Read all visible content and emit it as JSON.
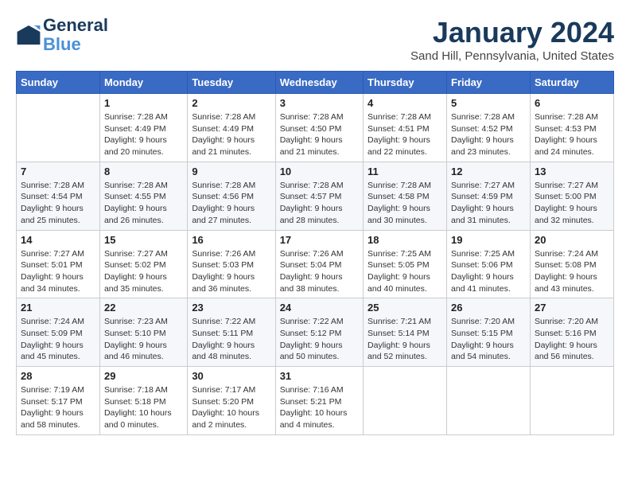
{
  "header": {
    "logo_line1": "General",
    "logo_line2": "Blue",
    "month_title": "January 2024",
    "location": "Sand Hill, Pennsylvania, United States"
  },
  "days_of_week": [
    "Sunday",
    "Monday",
    "Tuesday",
    "Wednesday",
    "Thursday",
    "Friday",
    "Saturday"
  ],
  "weeks": [
    [
      {
        "day": "",
        "info": ""
      },
      {
        "day": "1",
        "info": "Sunrise: 7:28 AM\nSunset: 4:49 PM\nDaylight: 9 hours\nand 20 minutes."
      },
      {
        "day": "2",
        "info": "Sunrise: 7:28 AM\nSunset: 4:49 PM\nDaylight: 9 hours\nand 21 minutes."
      },
      {
        "day": "3",
        "info": "Sunrise: 7:28 AM\nSunset: 4:50 PM\nDaylight: 9 hours\nand 21 minutes."
      },
      {
        "day": "4",
        "info": "Sunrise: 7:28 AM\nSunset: 4:51 PM\nDaylight: 9 hours\nand 22 minutes."
      },
      {
        "day": "5",
        "info": "Sunrise: 7:28 AM\nSunset: 4:52 PM\nDaylight: 9 hours\nand 23 minutes."
      },
      {
        "day": "6",
        "info": "Sunrise: 7:28 AM\nSunset: 4:53 PM\nDaylight: 9 hours\nand 24 minutes."
      }
    ],
    [
      {
        "day": "7",
        "info": "Sunrise: 7:28 AM\nSunset: 4:54 PM\nDaylight: 9 hours\nand 25 minutes."
      },
      {
        "day": "8",
        "info": "Sunrise: 7:28 AM\nSunset: 4:55 PM\nDaylight: 9 hours\nand 26 minutes."
      },
      {
        "day": "9",
        "info": "Sunrise: 7:28 AM\nSunset: 4:56 PM\nDaylight: 9 hours\nand 27 minutes."
      },
      {
        "day": "10",
        "info": "Sunrise: 7:28 AM\nSunset: 4:57 PM\nDaylight: 9 hours\nand 28 minutes."
      },
      {
        "day": "11",
        "info": "Sunrise: 7:28 AM\nSunset: 4:58 PM\nDaylight: 9 hours\nand 30 minutes."
      },
      {
        "day": "12",
        "info": "Sunrise: 7:27 AM\nSunset: 4:59 PM\nDaylight: 9 hours\nand 31 minutes."
      },
      {
        "day": "13",
        "info": "Sunrise: 7:27 AM\nSunset: 5:00 PM\nDaylight: 9 hours\nand 32 minutes."
      }
    ],
    [
      {
        "day": "14",
        "info": "Sunrise: 7:27 AM\nSunset: 5:01 PM\nDaylight: 9 hours\nand 34 minutes."
      },
      {
        "day": "15",
        "info": "Sunrise: 7:27 AM\nSunset: 5:02 PM\nDaylight: 9 hours\nand 35 minutes."
      },
      {
        "day": "16",
        "info": "Sunrise: 7:26 AM\nSunset: 5:03 PM\nDaylight: 9 hours\nand 36 minutes."
      },
      {
        "day": "17",
        "info": "Sunrise: 7:26 AM\nSunset: 5:04 PM\nDaylight: 9 hours\nand 38 minutes."
      },
      {
        "day": "18",
        "info": "Sunrise: 7:25 AM\nSunset: 5:05 PM\nDaylight: 9 hours\nand 40 minutes."
      },
      {
        "day": "19",
        "info": "Sunrise: 7:25 AM\nSunset: 5:06 PM\nDaylight: 9 hours\nand 41 minutes."
      },
      {
        "day": "20",
        "info": "Sunrise: 7:24 AM\nSunset: 5:08 PM\nDaylight: 9 hours\nand 43 minutes."
      }
    ],
    [
      {
        "day": "21",
        "info": "Sunrise: 7:24 AM\nSunset: 5:09 PM\nDaylight: 9 hours\nand 45 minutes."
      },
      {
        "day": "22",
        "info": "Sunrise: 7:23 AM\nSunset: 5:10 PM\nDaylight: 9 hours\nand 46 minutes."
      },
      {
        "day": "23",
        "info": "Sunrise: 7:22 AM\nSunset: 5:11 PM\nDaylight: 9 hours\nand 48 minutes."
      },
      {
        "day": "24",
        "info": "Sunrise: 7:22 AM\nSunset: 5:12 PM\nDaylight: 9 hours\nand 50 minutes."
      },
      {
        "day": "25",
        "info": "Sunrise: 7:21 AM\nSunset: 5:14 PM\nDaylight: 9 hours\nand 52 minutes."
      },
      {
        "day": "26",
        "info": "Sunrise: 7:20 AM\nSunset: 5:15 PM\nDaylight: 9 hours\nand 54 minutes."
      },
      {
        "day": "27",
        "info": "Sunrise: 7:20 AM\nSunset: 5:16 PM\nDaylight: 9 hours\nand 56 minutes."
      }
    ],
    [
      {
        "day": "28",
        "info": "Sunrise: 7:19 AM\nSunset: 5:17 PM\nDaylight: 9 hours\nand 58 minutes."
      },
      {
        "day": "29",
        "info": "Sunrise: 7:18 AM\nSunset: 5:18 PM\nDaylight: 10 hours\nand 0 minutes."
      },
      {
        "day": "30",
        "info": "Sunrise: 7:17 AM\nSunset: 5:20 PM\nDaylight: 10 hours\nand 2 minutes."
      },
      {
        "day": "31",
        "info": "Sunrise: 7:16 AM\nSunset: 5:21 PM\nDaylight: 10 hours\nand 4 minutes."
      },
      {
        "day": "",
        "info": ""
      },
      {
        "day": "",
        "info": ""
      },
      {
        "day": "",
        "info": ""
      }
    ]
  ]
}
